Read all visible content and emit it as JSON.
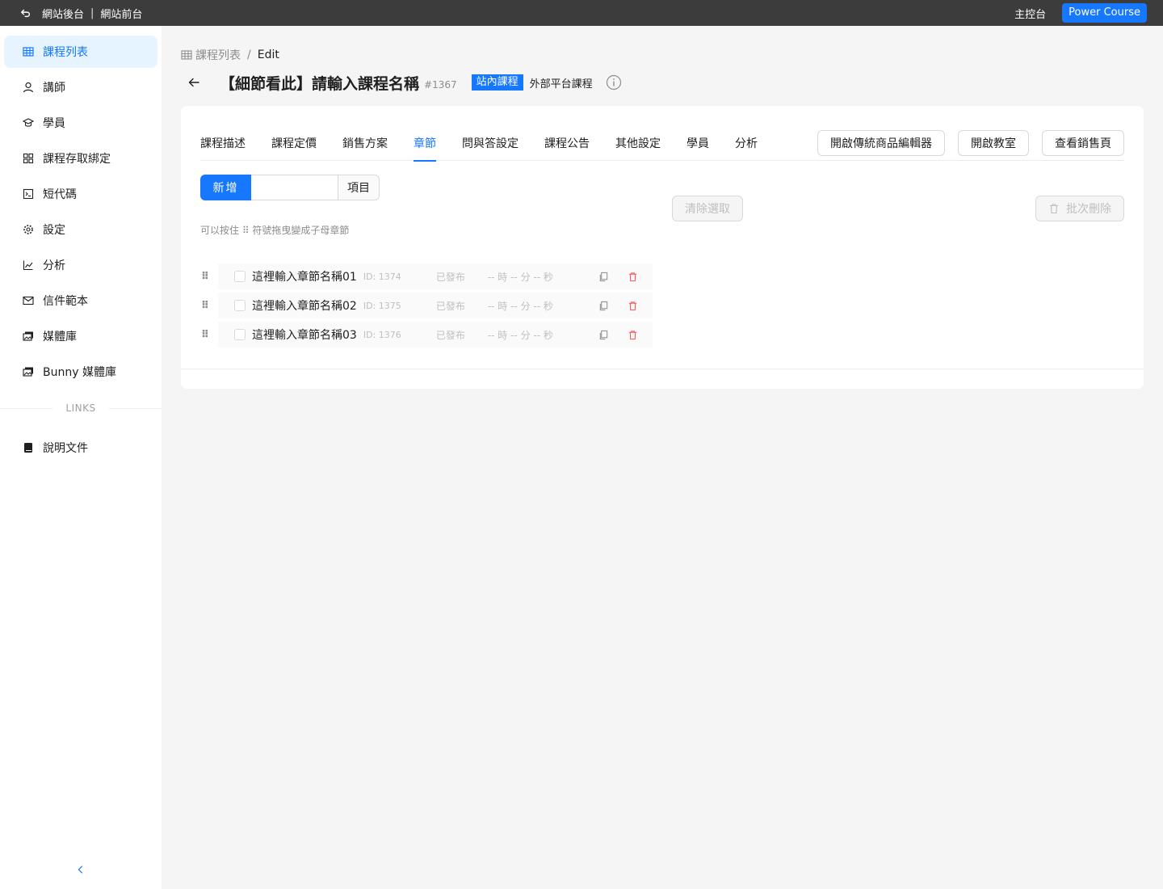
{
  "topbar": {
    "backend_label": "網站後台",
    "separator": "|",
    "frontend_label": "網站前台",
    "dashboard_label": "主控台",
    "brand_button": "Power Course"
  },
  "sidebar": {
    "items": [
      {
        "label": "課程列表",
        "icon": "table-icon",
        "active": true
      },
      {
        "label": "講師",
        "icon": "user-icon"
      },
      {
        "label": "學員",
        "icon": "graduation-cap-icon"
      },
      {
        "label": "課程存取綁定",
        "icon": "apps-icon"
      },
      {
        "label": "短代碼",
        "icon": "code-square-icon"
      },
      {
        "label": "設定",
        "icon": "gear-icon"
      },
      {
        "label": "分析",
        "icon": "line-chart-icon"
      },
      {
        "label": "信件範本",
        "icon": "mail-icon"
      },
      {
        "label": "媒體庫",
        "icon": "images-icon"
      },
      {
        "label": "Bunny 媒體庫",
        "icon": "images-icon"
      }
    ],
    "links_heading": "LINKS",
    "links": [
      {
        "label": "說明文件",
        "icon": "book-icon"
      }
    ]
  },
  "breadcrumb": {
    "parent": "課程列表",
    "separator": "/",
    "current": "Edit"
  },
  "header": {
    "title": "【細節看此】請輸入課程名稱",
    "id": "#1367",
    "badge_active": "站內課程",
    "badge_other": "外部平台課程"
  },
  "tabs": [
    "課程描述",
    "課程定價",
    "銷售方案",
    "章節",
    "問與答設定",
    "課程公告",
    "其他設定",
    "學員",
    "分析"
  ],
  "active_tab": "章節",
  "actions": {
    "classic_editor": "開啟傳統商品編輯器",
    "open_classroom": "開啟教室",
    "view_sales_page": "查看銷售頁"
  },
  "add_bar": {
    "button": "新增",
    "input_value": "",
    "suffix": "項目"
  },
  "clear_selection": "清除選取",
  "bulk_delete": "批次刪除",
  "hint": "可以按住 ⠿ 符號拖曳變成子母章節",
  "chapters": [
    {
      "title": "這裡輸入章節名稱01",
      "id": "ID: 1374",
      "status": "已發布",
      "duration": "-- 時 -- 分 -- 秒"
    },
    {
      "title": "這裡輸入章節名稱02",
      "id": "ID: 1375",
      "status": "已發布",
      "duration": "-- 時 -- 分 -- 秒"
    },
    {
      "title": "這裡輸入章節名稱03",
      "id": "ID: 1376",
      "status": "已發布",
      "duration": "-- 時 -- 分 -- 秒"
    }
  ],
  "colors": {
    "primary": "#1677ff",
    "danger": "#ff4d4f",
    "topbar": "#3c3c3c"
  }
}
